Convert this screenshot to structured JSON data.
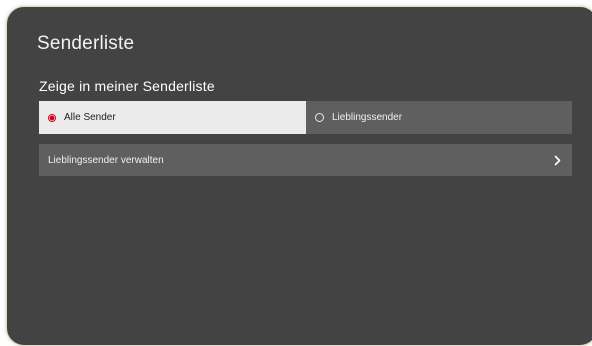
{
  "screen": {
    "title": "Senderliste"
  },
  "channel_filter": {
    "label": "Zeige in meiner Senderliste",
    "options": [
      {
        "label": "Alle Sender",
        "selected": true
      },
      {
        "label": "Lieblingssender",
        "selected": false
      }
    ]
  },
  "manage": {
    "label": "Lieblingssender verwalten",
    "icon": "chevron-right-icon"
  },
  "colors": {
    "background": "#434343",
    "selected_option": "#ebebeb",
    "row": "#5f5f5f",
    "accent": "#d0021b"
  }
}
